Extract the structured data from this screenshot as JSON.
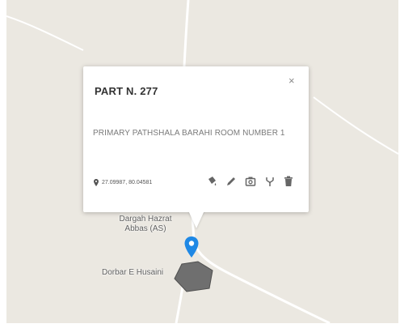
{
  "popup": {
    "title": "PART N. 277",
    "close_glyph": "×",
    "description": "PRIMARY PATHSHALA BARAHI ROOM NUMBER 1",
    "coordinates": "27.09987, 80.04581"
  },
  "map": {
    "labels": {
      "dargah": "Dargah Hazrat Abbas (AS)",
      "dorbar": "Dorbar E Husaini"
    },
    "colors": {
      "background": "#ebe8e1",
      "road": "#ffffff",
      "pin": "#1e88e5",
      "plot": "#6f6f6f"
    }
  },
  "icons": {
    "actions": [
      "fill-icon",
      "pencil-icon",
      "camera-icon",
      "merge-icon",
      "trash-icon"
    ],
    "location": "location-pin-icon"
  }
}
